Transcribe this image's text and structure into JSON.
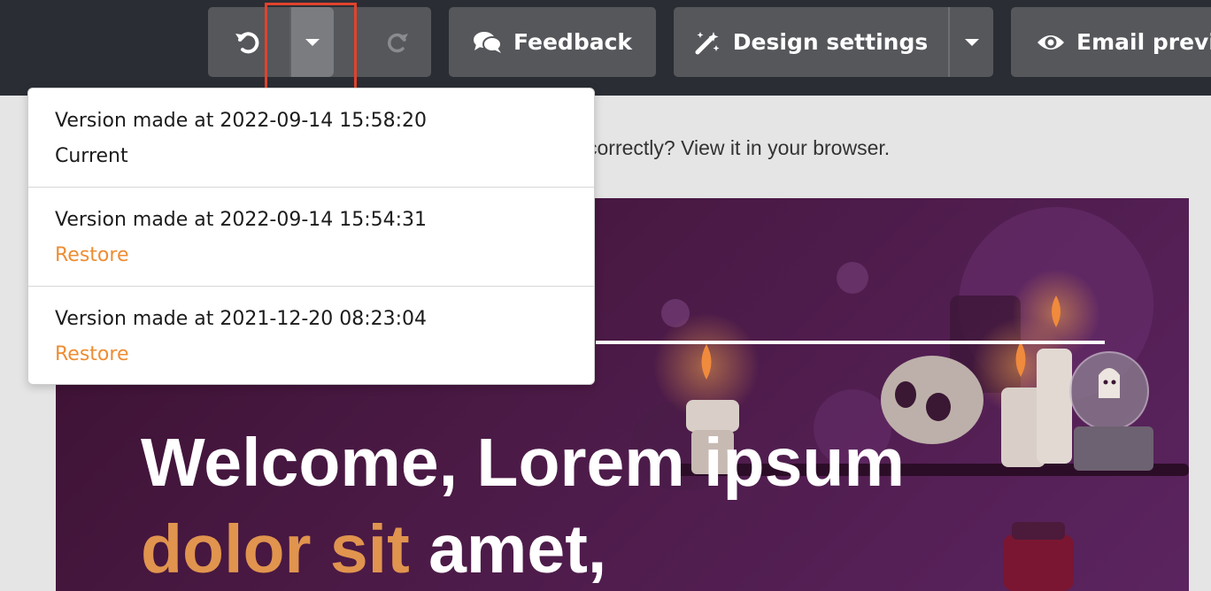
{
  "toolbar": {
    "undo_icon": "undo-icon",
    "undo_history_icon": "caret-down-icon",
    "redo_icon": "redo-icon",
    "feedback": {
      "label": "Feedback",
      "icon": "chat-bubbles-icon"
    },
    "design_settings": {
      "label": "Design settings",
      "icon": "magic-wand-icon",
      "caret_icon": "caret-down-icon"
    },
    "email_preview": {
      "label": "Email previe",
      "icon": "eye-icon"
    }
  },
  "colors": {
    "topbar": "#2b2d35",
    "button": "#55575b",
    "highlight": "#e0432d",
    "restore_link": "#ee8d33",
    "accent_text": "#e0944e"
  },
  "email": {
    "browser_notice": "correctly? View it in your browser.",
    "hero_title_line1": "Welcome, Lorem ipsum",
    "hero_title_accent": "dolor sit",
    "hero_title_rest": " amet,"
  },
  "version_history": {
    "items": [
      {
        "title": "Version made at 2022-09-14 15:58:20",
        "status": "Current"
      },
      {
        "title": "Version made at 2022-09-14 15:54:31",
        "action": "Restore"
      },
      {
        "title": "Version made at 2021-12-20 08:23:04",
        "action": "Restore"
      }
    ]
  }
}
